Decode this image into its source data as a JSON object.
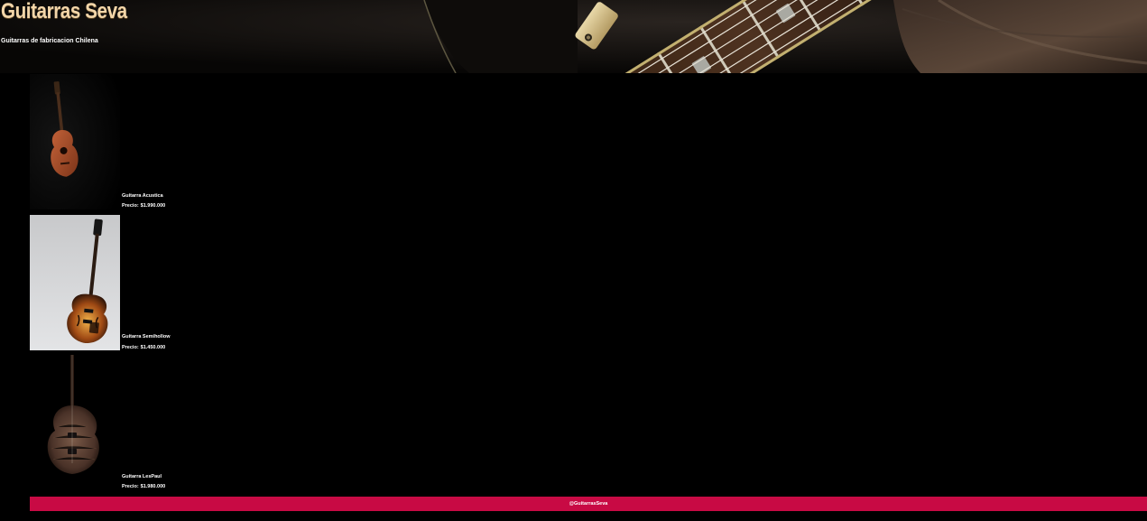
{
  "header": {
    "title": "Guitarras Seva",
    "subtitle": "Guitarras de fabricacion Chilena"
  },
  "products": [
    {
      "name": "Guitarra Acustica",
      "price_label": "Precio:",
      "price": "$1.990.000"
    },
    {
      "name": "Guitarra Semihollow",
      "price_label": "Precio:",
      "price": "$1.450.000"
    },
    {
      "name": "Guitarra LesPaul",
      "price_label": "Precio:",
      "price": "$1.980.000"
    }
  ],
  "footer": {
    "handle": "@GuitarrasSeva"
  },
  "colors": {
    "background": "#000000",
    "title": "#f3d6a9",
    "footer": "#c80a44"
  }
}
